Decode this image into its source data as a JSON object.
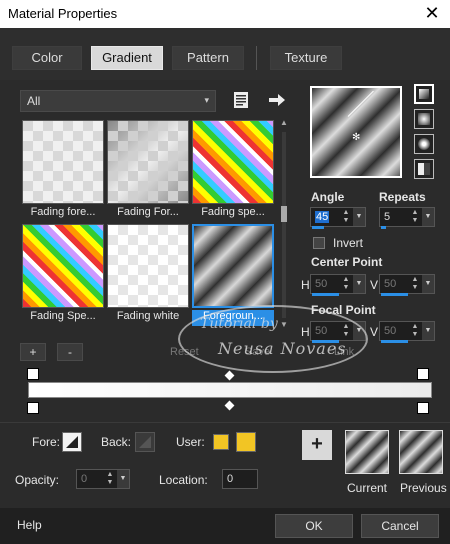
{
  "window": {
    "title": "Material Properties",
    "close_glyph": "✕"
  },
  "tabs": [
    {
      "label": "Color",
      "active": false
    },
    {
      "label": "Gradient",
      "active": true
    },
    {
      "label": "Pattern",
      "active": false
    },
    {
      "label": "Texture",
      "active": false
    }
  ],
  "preset": {
    "selected": "All",
    "arrow_glyph": "▾"
  },
  "thumbnails": [
    {
      "label": "Fading fore..."
    },
    {
      "label": "Fading For..."
    },
    {
      "label": "Fading spe..."
    },
    {
      "label": "Fading Spe..."
    },
    {
      "label": "Fading white"
    },
    {
      "label": "Foregroun...",
      "selected": true
    }
  ],
  "angle": {
    "label": "Angle",
    "value": "45"
  },
  "repeats": {
    "label": "Repeats",
    "value": "5"
  },
  "invert": {
    "label": "Invert",
    "checked": false
  },
  "center_point": {
    "label": "Center Point",
    "h_label": "H",
    "h_value": "50",
    "v_label": "V",
    "v_value": "50"
  },
  "focal_point": {
    "label": "Focal Point",
    "h_label": "H",
    "h_value": "50",
    "v_label": "V",
    "v_value": "50"
  },
  "gradient_editor": {
    "add_label": "+",
    "remove_label": "-",
    "reset_label": "Reset",
    "save_label": "Save",
    "link_label": "Link"
  },
  "watermark": {
    "line1": "Tutorial by",
    "line2": "Neusa Novaes"
  },
  "lower": {
    "fore_label": "Fore:",
    "back_label": "Back:",
    "user_label": "User:",
    "user_color": "#f2c524",
    "opacity_label": "Opacity:",
    "opacity_value": "0",
    "location_label": "Location:",
    "location_value": "0",
    "add_glyph": "+",
    "current_label": "Current",
    "previous_label": "Previous"
  },
  "footer": {
    "help_label": "Help",
    "ok_label": "OK",
    "cancel_label": "Cancel"
  }
}
